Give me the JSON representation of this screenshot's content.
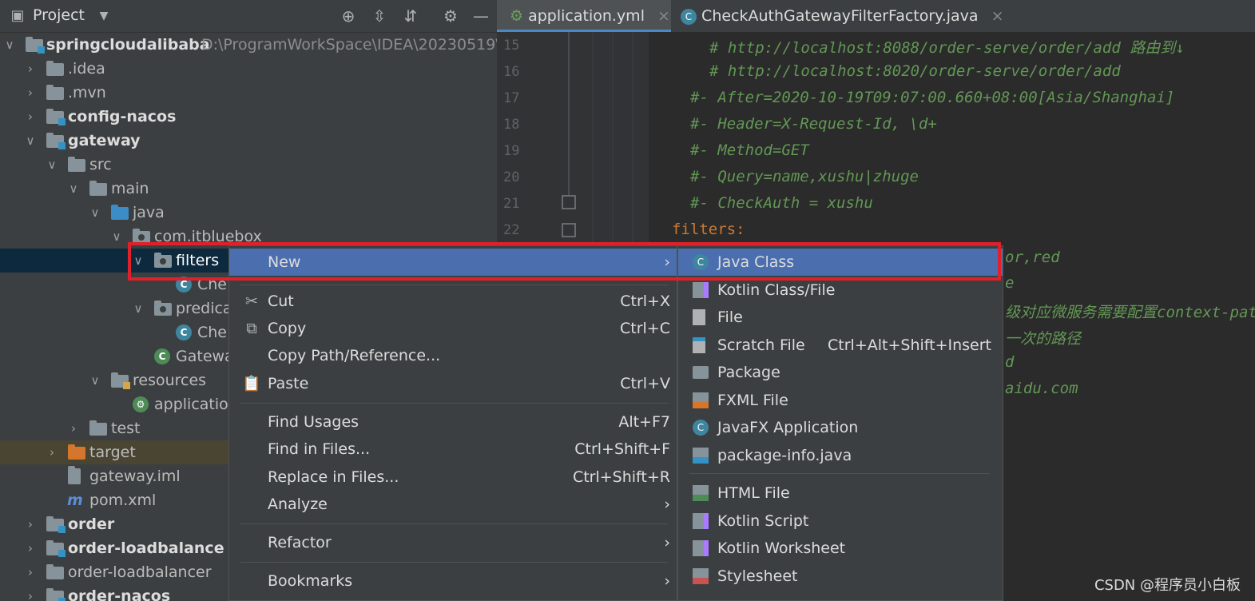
{
  "project_panel": {
    "title": "Project",
    "tree": [
      {
        "label": "springcloudalibaba",
        "path": "D:\\ProgramWorkSpace\\IDEA\\20230519\\s"
      },
      {
        "label": ".idea"
      },
      {
        "label": ".mvn"
      },
      {
        "label": "config-nacos"
      },
      {
        "label": "gateway"
      },
      {
        "label": "src"
      },
      {
        "label": "main"
      },
      {
        "label": "java"
      },
      {
        "label": "com.itbluebox"
      },
      {
        "label": "filters"
      },
      {
        "label": "Che"
      },
      {
        "label": "predica"
      },
      {
        "label": "Che"
      },
      {
        "label": "Gatewa"
      },
      {
        "label": "resources"
      },
      {
        "label": "applicatio"
      },
      {
        "label": "test"
      },
      {
        "label": "target"
      },
      {
        "label": "gateway.iml"
      },
      {
        "label": "pom.xml"
      },
      {
        "label": "order"
      },
      {
        "label": "order-loadbalance"
      },
      {
        "label": "order-loadbalancer"
      },
      {
        "label": "order-nacos"
      }
    ]
  },
  "editor": {
    "tabs": [
      {
        "label": "application.yml",
        "active": true
      },
      {
        "label": "CheckAuthGatewayFilterFactory.java",
        "active": false
      }
    ],
    "lines": [
      {
        "num": "15",
        "text": "# http://localhost:8088/order-serve/order/add  路由到↓"
      },
      {
        "num": "16",
        "text": "# http://localhost:8020/order-serve/order/add"
      },
      {
        "num": "17",
        "text": "#- After=2020-10-19T09:07:00.660+08:00[Asia/Shanghai]"
      },
      {
        "num": "18",
        "text": "#- Header=X-Request-Id, \\d+"
      },
      {
        "num": "19",
        "text": "#- Method=GET"
      },
      {
        "num": "20",
        "text": "#- Query=name,xushu|zhuge"
      },
      {
        "num": "21",
        "text": "#- CheckAuth = xushu"
      },
      {
        "num": "22",
        "text": "filters:"
      }
    ],
    "partial_lines": [
      "or,red",
      "e",
      "级对应微服务需要配置context-pat",
      "一次的路径",
      "d",
      "aidu.com"
    ]
  },
  "context_menu": {
    "items": [
      {
        "label": "New",
        "shortcut": "",
        "submenu": true,
        "icon": ""
      },
      {
        "label": "Cut",
        "shortcut": "Ctrl+X",
        "icon": "scissors-icon"
      },
      {
        "label": "Copy",
        "shortcut": "Ctrl+C",
        "icon": "copy-icon"
      },
      {
        "label": "Copy Path/Reference...",
        "shortcut": ""
      },
      {
        "label": "Paste",
        "shortcut": "Ctrl+V",
        "icon": "paste-icon"
      },
      {
        "label": "Find Usages",
        "shortcut": "Alt+F7"
      },
      {
        "label": "Find in Files...",
        "shortcut": "Ctrl+Shift+F"
      },
      {
        "label": "Replace in Files...",
        "shortcut": "Ctrl+Shift+R"
      },
      {
        "label": "Analyze",
        "shortcut": "",
        "submenu": true
      },
      {
        "label": "Refactor",
        "shortcut": "",
        "submenu": true
      },
      {
        "label": "Bookmarks",
        "shortcut": "",
        "submenu": true
      }
    ]
  },
  "new_submenu": {
    "items": [
      {
        "label": "Java Class",
        "shortcut": ""
      },
      {
        "label": "Kotlin Class/File",
        "shortcut": ""
      },
      {
        "label": "File",
        "shortcut": ""
      },
      {
        "label": "Scratch File",
        "shortcut": "Ctrl+Alt+Shift+Insert"
      },
      {
        "label": "Package",
        "shortcut": ""
      },
      {
        "label": "FXML File",
        "shortcut": ""
      },
      {
        "label": "JavaFX Application",
        "shortcut": ""
      },
      {
        "label": "package-info.java",
        "shortcut": ""
      },
      {
        "label": "HTML File",
        "shortcut": ""
      },
      {
        "label": "Kotlin Script",
        "shortcut": ""
      },
      {
        "label": "Kotlin Worksheet",
        "shortcut": ""
      },
      {
        "label": "Stylesheet",
        "shortcut": ""
      }
    ]
  },
  "watermark": "CSDN @程序员小白板",
  "colors": {
    "accent": "#4b6eaf",
    "highlight_box": "#e0202a",
    "comment": "#629755",
    "keyword": "#cc7832"
  }
}
